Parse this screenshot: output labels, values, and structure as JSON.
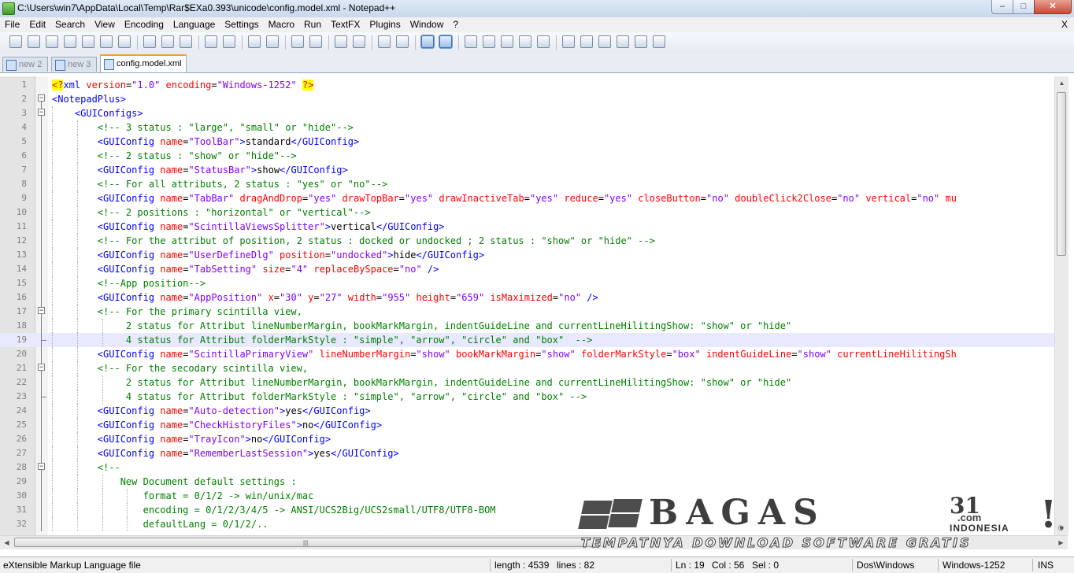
{
  "window": {
    "title": "C:\\Users\\win7\\AppData\\Local\\Temp\\Rar$EXa0.393\\unicode\\config.model.xml - Notepad++",
    "minimize_glyph": "–",
    "maximize_glyph": "□",
    "close_glyph": "✕"
  },
  "menu": {
    "items": [
      "File",
      "Edit",
      "Search",
      "View",
      "Encoding",
      "Language",
      "Settings",
      "Macro",
      "Run",
      "TextFX",
      "Plugins",
      "Window",
      "?"
    ],
    "close_label": "X"
  },
  "toolbar": {
    "buttons": [
      "new-file-icon",
      "open-file-icon",
      "save-icon",
      "save-all-icon",
      "close-icon",
      "close-all-icon",
      "print-icon",
      "cut-icon",
      "copy-icon",
      "paste-icon",
      "undo-icon",
      "redo-icon",
      "find-icon",
      "replace-icon",
      "zoom-in-icon",
      "zoom-out-icon",
      "sync-vertical-icon",
      "sync-horizontal-icon",
      "word-wrap-icon",
      "show-all-chars-icon",
      "indent-guide-icon",
      "user-language-icon",
      "record-macro-icon",
      "stop-record-icon",
      "play-macro-icon",
      "run-macro-multiple-icon",
      "save-macro-icon",
      "textfx-1-icon",
      "textfx-2-icon",
      "textfx-3-icon",
      "textfx-4-icon",
      "textfx-5-icon",
      "spell-check-icon"
    ],
    "active": [
      "indent-guide-icon",
      "user-language-icon"
    ]
  },
  "tabs": [
    {
      "label": "new  2",
      "active": false
    },
    {
      "label": "new  3",
      "active": false
    },
    {
      "label": "config.model.xml",
      "active": true
    }
  ],
  "editor": {
    "current_line": 19,
    "lines": [
      {
        "n": "1",
        "indent": 0,
        "fold": "none",
        "tokens": [
          [
            "decl",
            "<?"
          ],
          [
            "tag",
            "xml "
          ],
          [
            "attr",
            "version"
          ],
          [
            "txt",
            "="
          ],
          [
            "val",
            "\"1.0\" "
          ],
          [
            "attr",
            "encoding"
          ],
          [
            "txt",
            "="
          ],
          [
            "val",
            "\"Windows-1252\" "
          ],
          [
            "decl",
            "?>"
          ]
        ]
      },
      {
        "n": "2",
        "indent": 0,
        "fold": "open",
        "tokens": [
          [
            "tag",
            "<NotepadPlus>"
          ]
        ]
      },
      {
        "n": "3",
        "indent": 1,
        "fold": "open",
        "tokens": [
          [
            "tag",
            "<GUIConfigs>"
          ]
        ]
      },
      {
        "n": "4",
        "indent": 2,
        "fold": "line",
        "tokens": [
          [
            "com",
            "<!-- 3 status : \"large\", \"small\" or \"hide\"-->"
          ]
        ]
      },
      {
        "n": "5",
        "indent": 2,
        "fold": "line",
        "tokens": [
          [
            "tag",
            "<GUIConfig "
          ],
          [
            "attr",
            "name"
          ],
          [
            "txt",
            "="
          ],
          [
            "val",
            "\"ToolBar\""
          ],
          [
            "tag",
            ">"
          ],
          [
            "txt",
            "standard"
          ],
          [
            "tag",
            "</GUIConfig>"
          ]
        ]
      },
      {
        "n": "6",
        "indent": 2,
        "fold": "line",
        "tokens": [
          [
            "com",
            "<!-- 2 status : \"show\" or \"hide\"-->"
          ]
        ]
      },
      {
        "n": "7",
        "indent": 2,
        "fold": "line",
        "tokens": [
          [
            "tag",
            "<GUIConfig "
          ],
          [
            "attr",
            "name"
          ],
          [
            "txt",
            "="
          ],
          [
            "val",
            "\"StatusBar\""
          ],
          [
            "tag",
            ">"
          ],
          [
            "txt",
            "show"
          ],
          [
            "tag",
            "</GUIConfig>"
          ]
        ]
      },
      {
        "n": "8",
        "indent": 2,
        "fold": "line",
        "tokens": [
          [
            "com",
            "<!-- For all attributs, 2 status : \"yes\" or \"no\"-->"
          ]
        ]
      },
      {
        "n": "9",
        "indent": 2,
        "fold": "line",
        "tokens": [
          [
            "tag",
            "<GUIConfig "
          ],
          [
            "attr",
            "name"
          ],
          [
            "txt",
            "="
          ],
          [
            "val",
            "\"TabBar\" "
          ],
          [
            "attr",
            "dragAndDrop"
          ],
          [
            "txt",
            "="
          ],
          [
            "val",
            "\"yes\" "
          ],
          [
            "attr",
            "drawTopBar"
          ],
          [
            "txt",
            "="
          ],
          [
            "val",
            "\"yes\" "
          ],
          [
            "attr",
            "drawInactiveTab"
          ],
          [
            "txt",
            "="
          ],
          [
            "val",
            "\"yes\" "
          ],
          [
            "attr",
            "reduce"
          ],
          [
            "txt",
            "="
          ],
          [
            "val",
            "\"yes\" "
          ],
          [
            "attr",
            "closeButton"
          ],
          [
            "txt",
            "="
          ],
          [
            "val",
            "\"no\" "
          ],
          [
            "attr",
            "doubleClick2Close"
          ],
          [
            "txt",
            "="
          ],
          [
            "val",
            "\"no\" "
          ],
          [
            "attr",
            "vertical"
          ],
          [
            "txt",
            "="
          ],
          [
            "val",
            "\"no\" "
          ],
          [
            "attr",
            "mu"
          ]
        ]
      },
      {
        "n": "10",
        "indent": 2,
        "fold": "line",
        "tokens": [
          [
            "com",
            "<!-- 2 positions : \"horizontal\" or \"vertical\"-->"
          ]
        ]
      },
      {
        "n": "11",
        "indent": 2,
        "fold": "line",
        "tokens": [
          [
            "tag",
            "<GUIConfig "
          ],
          [
            "attr",
            "name"
          ],
          [
            "txt",
            "="
          ],
          [
            "val",
            "\"ScintillaViewsSplitter\""
          ],
          [
            "tag",
            ">"
          ],
          [
            "txt",
            "vertical"
          ],
          [
            "tag",
            "</GUIConfig>"
          ]
        ]
      },
      {
        "n": "12",
        "indent": 2,
        "fold": "line",
        "tokens": [
          [
            "com",
            "<!-- For the attribut of position, 2 status : docked or undocked ; 2 status : \"show\" or \"hide\" -->"
          ]
        ]
      },
      {
        "n": "13",
        "indent": 2,
        "fold": "line",
        "tokens": [
          [
            "tag",
            "<GUIConfig "
          ],
          [
            "attr",
            "name"
          ],
          [
            "txt",
            "="
          ],
          [
            "val",
            "\"UserDefineDlg\" "
          ],
          [
            "attr",
            "position"
          ],
          [
            "txt",
            "="
          ],
          [
            "val",
            "\"undocked\""
          ],
          [
            "tag",
            ">"
          ],
          [
            "txt",
            "hide"
          ],
          [
            "tag",
            "</GUIConfig>"
          ]
        ]
      },
      {
        "n": "14",
        "indent": 2,
        "fold": "line",
        "tokens": [
          [
            "tag",
            "<GUIConfig "
          ],
          [
            "attr",
            "name"
          ],
          [
            "txt",
            "="
          ],
          [
            "val",
            "\"TabSetting\" "
          ],
          [
            "attr",
            "size"
          ],
          [
            "txt",
            "="
          ],
          [
            "val",
            "\"4\" "
          ],
          [
            "attr",
            "replaceBySpace"
          ],
          [
            "txt",
            "="
          ],
          [
            "val",
            "\"no\" "
          ],
          [
            "tag",
            "/>"
          ]
        ]
      },
      {
        "n": "15",
        "indent": 2,
        "fold": "line",
        "tokens": [
          [
            "com",
            "<!--App position-->"
          ]
        ]
      },
      {
        "n": "16",
        "indent": 2,
        "fold": "line",
        "tokens": [
          [
            "tag",
            "<GUIConfig "
          ],
          [
            "attr",
            "name"
          ],
          [
            "txt",
            "="
          ],
          [
            "val",
            "\"AppPosition\" "
          ],
          [
            "attr",
            "x"
          ],
          [
            "txt",
            "="
          ],
          [
            "val",
            "\"30\" "
          ],
          [
            "attr",
            "y"
          ],
          [
            "txt",
            "="
          ],
          [
            "val",
            "\"27\" "
          ],
          [
            "attr",
            "width"
          ],
          [
            "txt",
            "="
          ],
          [
            "val",
            "\"955\" "
          ],
          [
            "attr",
            "height"
          ],
          [
            "txt",
            "="
          ],
          [
            "val",
            "\"659\" "
          ],
          [
            "attr",
            "isMaximized"
          ],
          [
            "txt",
            "="
          ],
          [
            "val",
            "\"no\" "
          ],
          [
            "tag",
            "/>"
          ]
        ]
      },
      {
        "n": "17",
        "indent": 2,
        "fold": "open",
        "tokens": [
          [
            "com",
            "<!-- For the primary scintilla view,"
          ]
        ]
      },
      {
        "n": "18",
        "indent": 3,
        "fold": "line",
        "tokens": [
          [
            "com",
            " 2 status for Attribut lineNumberMargin, bookMarkMargin, indentGuideLine and currentLineHilitingShow: \"show\" or \"hide\""
          ]
        ]
      },
      {
        "n": "19",
        "indent": 3,
        "fold": "end",
        "tokens": [
          [
            "com",
            " 4 status for Attribut folderMarkStyle : \"simple\", \"arrow\", \"circle\" and \"box\"  -->"
          ]
        ]
      },
      {
        "n": "20",
        "indent": 2,
        "fold": "line",
        "tokens": [
          [
            "tag",
            "<GUIConfig "
          ],
          [
            "attr",
            "name"
          ],
          [
            "txt",
            "="
          ],
          [
            "val",
            "\"ScintillaPrimaryView\" "
          ],
          [
            "attr",
            "lineNumberMargin"
          ],
          [
            "txt",
            "="
          ],
          [
            "val",
            "\"show\" "
          ],
          [
            "attr",
            "bookMarkMargin"
          ],
          [
            "txt",
            "="
          ],
          [
            "val",
            "\"show\" "
          ],
          [
            "attr",
            "folderMarkStyle"
          ],
          [
            "txt",
            "="
          ],
          [
            "val",
            "\"box\" "
          ],
          [
            "attr",
            "indentGuideLine"
          ],
          [
            "txt",
            "="
          ],
          [
            "val",
            "\"show\" "
          ],
          [
            "attr",
            "currentLineHilitingSh"
          ]
        ]
      },
      {
        "n": "21",
        "indent": 2,
        "fold": "open",
        "tokens": [
          [
            "com",
            "<!-- For the secodary scintilla view,"
          ]
        ]
      },
      {
        "n": "22",
        "indent": 3,
        "fold": "line",
        "tokens": [
          [
            "com",
            " 2 status for Attribut lineNumberMargin, bookMarkMargin, indentGuideLine and currentLineHilitingShow: \"show\" or \"hide\""
          ]
        ]
      },
      {
        "n": "23",
        "indent": 3,
        "fold": "end",
        "tokens": [
          [
            "com",
            " 4 status for Attribut folderMarkStyle : \"simple\", \"arrow\", \"circle\" and \"box\" -->"
          ]
        ]
      },
      {
        "n": "24",
        "indent": 2,
        "fold": "line",
        "tokens": [
          [
            "tag",
            "<GUIConfig "
          ],
          [
            "attr",
            "name"
          ],
          [
            "txt",
            "="
          ],
          [
            "val",
            "\"Auto-detection\""
          ],
          [
            "tag",
            ">"
          ],
          [
            "txt",
            "yes"
          ],
          [
            "tag",
            "</GUIConfig>"
          ]
        ]
      },
      {
        "n": "25",
        "indent": 2,
        "fold": "line",
        "tokens": [
          [
            "tag",
            "<GUIConfig "
          ],
          [
            "attr",
            "name"
          ],
          [
            "txt",
            "="
          ],
          [
            "val",
            "\"CheckHistoryFiles\""
          ],
          [
            "tag",
            ">"
          ],
          [
            "txt",
            "no"
          ],
          [
            "tag",
            "</GUIConfig>"
          ]
        ]
      },
      {
        "n": "26",
        "indent": 2,
        "fold": "line",
        "tokens": [
          [
            "tag",
            "<GUIConfig "
          ],
          [
            "attr",
            "name"
          ],
          [
            "txt",
            "="
          ],
          [
            "val",
            "\"TrayIcon\""
          ],
          [
            "tag",
            ">"
          ],
          [
            "txt",
            "no"
          ],
          [
            "tag",
            "</GUIConfig>"
          ]
        ]
      },
      {
        "n": "27",
        "indent": 2,
        "fold": "line",
        "tokens": [
          [
            "tag",
            "<GUIConfig "
          ],
          [
            "attr",
            "name"
          ],
          [
            "txt",
            "="
          ],
          [
            "val",
            "\"RememberLastSession\""
          ],
          [
            "tag",
            ">"
          ],
          [
            "txt",
            "yes"
          ],
          [
            "tag",
            "</GUIConfig>"
          ]
        ]
      },
      {
        "n": "28",
        "indent": 2,
        "fold": "open",
        "tokens": [
          [
            "com",
            "<!--"
          ]
        ]
      },
      {
        "n": "29",
        "indent": 3,
        "fold": "line",
        "tokens": [
          [
            "com",
            "New Document default settings :"
          ]
        ]
      },
      {
        "n": "30",
        "indent": 4,
        "fold": "line",
        "tokens": [
          [
            "com",
            "format = 0/1/2 -> win/unix/mac"
          ]
        ]
      },
      {
        "n": "31",
        "indent": 4,
        "fold": "line",
        "tokens": [
          [
            "com",
            "encoding = 0/1/2/3/4/5 -> ANSI/UCS2Big/UCS2small/UTF8/UTF8-BOM"
          ]
        ]
      },
      {
        "n": "32",
        "indent": 4,
        "fold": "line",
        "tokens": [
          [
            "com",
            "defaultLang = 0/1/2/.."
          ]
        ]
      }
    ]
  },
  "scrollbars": {
    "up_glyph": "▲",
    "down_glyph": "▼",
    "left_glyph": "◀",
    "right_glyph": "▶",
    "grip_glyph": "|||"
  },
  "watermark": {
    "brand": "BAGAS",
    "number": "31",
    "dotcom": ".com",
    "country": "INDONESIA",
    "bang": "!",
    "registered": "®",
    "tagline": "TEMPATNYA DOWNLOAD SOFTWARE GRATIS"
  },
  "statusbar": {
    "file_type": "eXtensible Markup Language file",
    "length": "length : 4539",
    "lines": "lines : 82",
    "ln": "Ln : 19",
    "col": "Col : 56",
    "sel": "Sel : 0",
    "eol": "Dos\\Windows",
    "encoding": "Windows-1252",
    "mode": "INS"
  },
  "colors": {
    "tag": "#0000ff",
    "attr": "#ff0000",
    "value": "#8000ff",
    "comment": "#008000",
    "decl_bg": "#ffff00",
    "current_line": "#e8e8ff",
    "tab_accent": "#f7a21b"
  }
}
